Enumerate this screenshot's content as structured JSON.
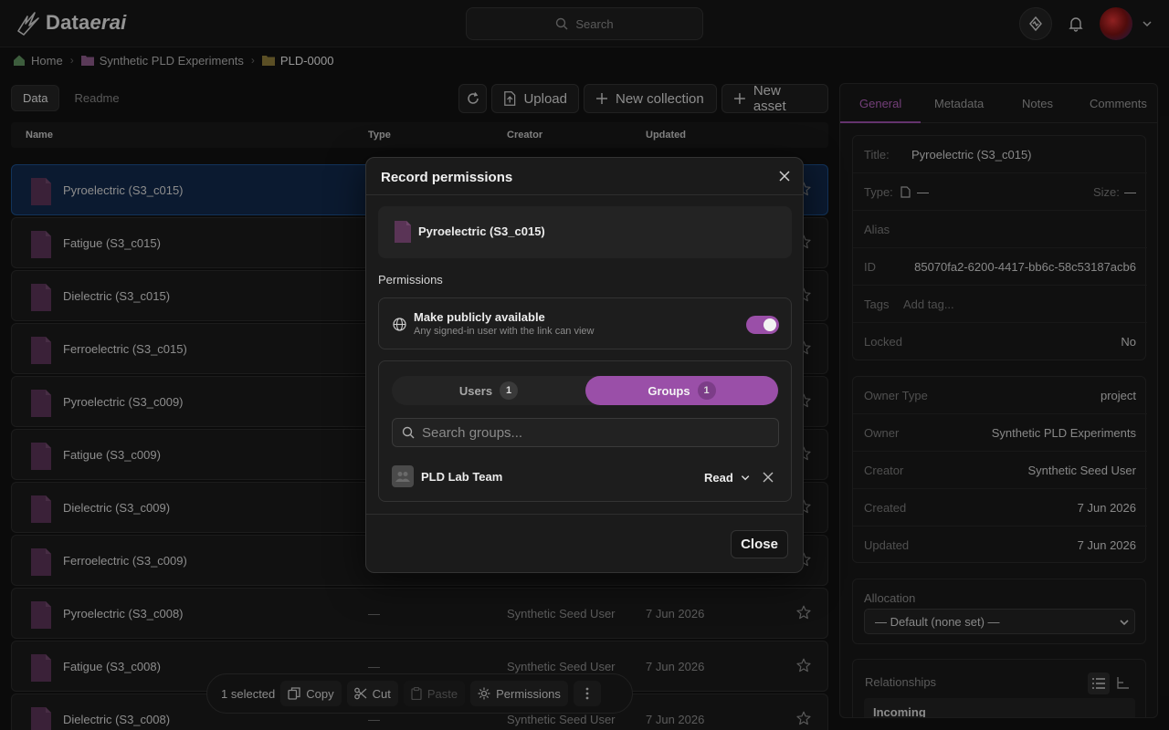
{
  "app": {
    "name_prefix": "Data",
    "name_suffix": "erai"
  },
  "search": {
    "placeholder": "Search"
  },
  "breadcrumb": [
    {
      "label": "Home",
      "icon": "home-icon"
    },
    {
      "label": "Synthetic PLD Experiments",
      "icon": "folder-icon"
    },
    {
      "label": "PLD-0000",
      "icon": "folder-icon"
    }
  ],
  "left_tabs": [
    {
      "label": "Data"
    },
    {
      "label": "Readme"
    }
  ],
  "toolbar": {
    "upload": "Upload",
    "new_collection": "New collection",
    "new_asset": "New asset"
  },
  "table": {
    "headers": {
      "name": "Name",
      "type": "Type",
      "creator": "Creator",
      "updated": "Updated"
    },
    "rows": [
      {
        "name": "Pyroelectric (S3_c015)",
        "type": "",
        "creator": "",
        "updated": ""
      },
      {
        "name": "Fatigue (S3_c015)",
        "type": "",
        "creator": "",
        "updated": ""
      },
      {
        "name": "Dielectric (S3_c015)",
        "type": "",
        "creator": "",
        "updated": ""
      },
      {
        "name": "Ferroelectric (S3_c015)",
        "type": "",
        "creator": "",
        "updated": ""
      },
      {
        "name": "Pyroelectric (S3_c009)",
        "type": "",
        "creator": "",
        "updated": ""
      },
      {
        "name": "Fatigue (S3_c009)",
        "type": "",
        "creator": "",
        "updated": ""
      },
      {
        "name": "Dielectric (S3_c009)",
        "type": "",
        "creator": "",
        "updated": ""
      },
      {
        "name": "Ferroelectric (S3_c009)",
        "type": "",
        "creator": "",
        "updated": ""
      },
      {
        "name": "Pyroelectric (S3_c008)",
        "type": "—",
        "creator": "Synthetic Seed User",
        "updated": "7 Jun 2026"
      },
      {
        "name": "Fatigue (S3_c008)",
        "type": "—",
        "creator": "Synthetic Seed User",
        "updated": "7 Jun 2026"
      },
      {
        "name": "Dielectric (S3_c008)",
        "type": "—",
        "creator": "Synthetic Seed User",
        "updated": "7 Jun 2026"
      }
    ]
  },
  "right_panel": {
    "tabs": [
      {
        "label": "General"
      },
      {
        "label": "Metadata"
      },
      {
        "label": "Notes"
      },
      {
        "label": "Comments"
      }
    ],
    "title_label": "Title:",
    "title_value": "Pyroelectric (S3_c015)",
    "type_label": "Type:",
    "type_value": "—",
    "size_label": "Size:",
    "size_value": "—",
    "alias_label": "Alias",
    "id_label": "ID",
    "id_value": "85070fa2-6200-4417-bb6c-58c53187acb6",
    "tags_label": "Tags",
    "tags_placeholder": "Add tag...",
    "locked_label": "Locked",
    "locked_value": "No",
    "owner_type_label": "Owner Type",
    "owner_type_value": "project",
    "owner_label": "Owner",
    "owner_value": "Synthetic PLD Experiments",
    "creator_label": "Creator",
    "creator_value": "Synthetic Seed User",
    "created_label": "Created",
    "created_value": "7 Jun 2026",
    "updated_label": "Updated",
    "updated_value": "7 Jun 2026",
    "allocation_label": "Allocation",
    "allocation_value": "— Default (none set) —",
    "relationships_label": "Relationships",
    "incoming_label": "Incoming"
  },
  "modal": {
    "title": "Record permissions",
    "file_name": "Pyroelectric (S3_c015)",
    "permissions_label": "Permissions",
    "public_title": "Make publicly available",
    "public_subtitle": "Any signed-in user with the link can view",
    "public_enabled": true,
    "users_tab": "Users",
    "users_count": "1",
    "groups_tab": "Groups",
    "groups_count": "1",
    "search_placeholder": "Search groups...",
    "group_name": "PLD Lab Team",
    "group_role": "Read",
    "close_label": "Close"
  },
  "selection_bar": {
    "count": "1 selected",
    "copy": "Copy",
    "cut": "Cut",
    "paste": "Paste",
    "permissions": "Permissions"
  },
  "colors": {
    "accent": "#9a4fa8",
    "selected_row": "#12294a",
    "file_icon": "#5a3456"
  }
}
